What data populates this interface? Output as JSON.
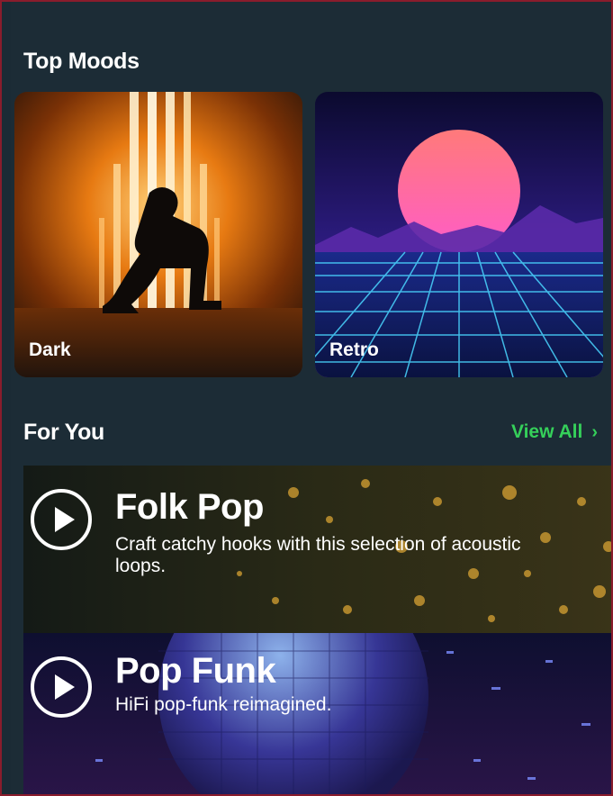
{
  "top_moods": {
    "title": "Top Moods",
    "cards": [
      {
        "label": "Dark"
      },
      {
        "label": "Retro"
      }
    ]
  },
  "for_you": {
    "title": "For You",
    "view_all_label": "View All",
    "view_all_icon": "chevron-right-icon",
    "playlists": [
      {
        "title": "Folk Pop",
        "description": "Craft catchy hooks with this selection of acoustic loops.",
        "icon": "play-icon"
      },
      {
        "title": "Pop Funk",
        "description": "HiFi pop-funk reimagined.",
        "icon": "play-icon"
      }
    ]
  },
  "colors": {
    "background": "#1c2c36",
    "accent": "#35d05a",
    "text": "#ffffff"
  }
}
